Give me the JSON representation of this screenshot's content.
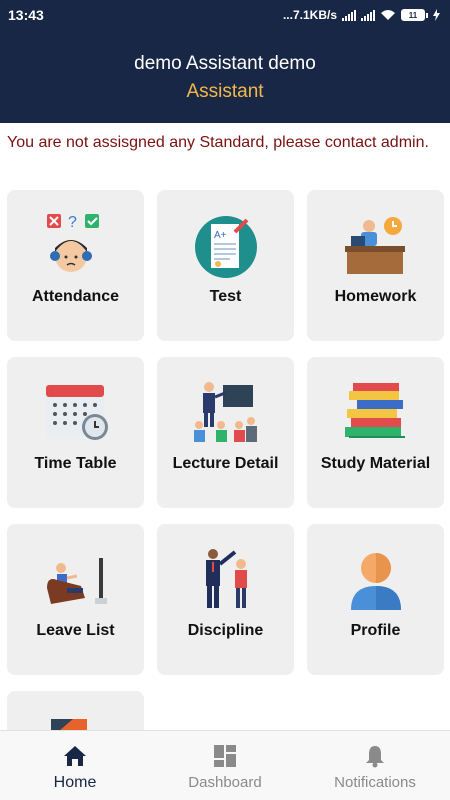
{
  "status_bar": {
    "time": "13:43",
    "network_speed": "...7.1KB/s",
    "battery": "11"
  },
  "header": {
    "name": "demo Assistant demo",
    "role": "Assistant"
  },
  "notice": "You are not assisgned any Standard, please contact admin.",
  "tiles": [
    {
      "label": "Attendance",
      "icon": "attendance-icon"
    },
    {
      "label": "Test",
      "icon": "test-icon"
    },
    {
      "label": "Homework",
      "icon": "homework-icon"
    },
    {
      "label": "Time Table",
      "icon": "calendar-icon"
    },
    {
      "label": "Lecture Detail",
      "icon": "lecture-icon"
    },
    {
      "label": "Study Material",
      "icon": "books-icon"
    },
    {
      "label": "Leave List",
      "icon": "leave-icon"
    },
    {
      "label": "Discipline",
      "icon": "discipline-icon"
    },
    {
      "label": "Profile",
      "icon": "profile-icon"
    },
    {
      "label": "",
      "icon": "partial-tile-icon"
    }
  ],
  "bottom_nav": [
    {
      "label": "Home",
      "icon": "home-icon",
      "active": true
    },
    {
      "label": "Dashboard",
      "icon": "dashboard-icon",
      "active": false
    },
    {
      "label": "Notifications",
      "icon": "bell-icon",
      "active": false
    }
  ],
  "colors": {
    "header_bg": "#182745",
    "role_text": "#f2b84b",
    "notice_text": "#7b1010",
    "tile_bg": "#efefef"
  }
}
